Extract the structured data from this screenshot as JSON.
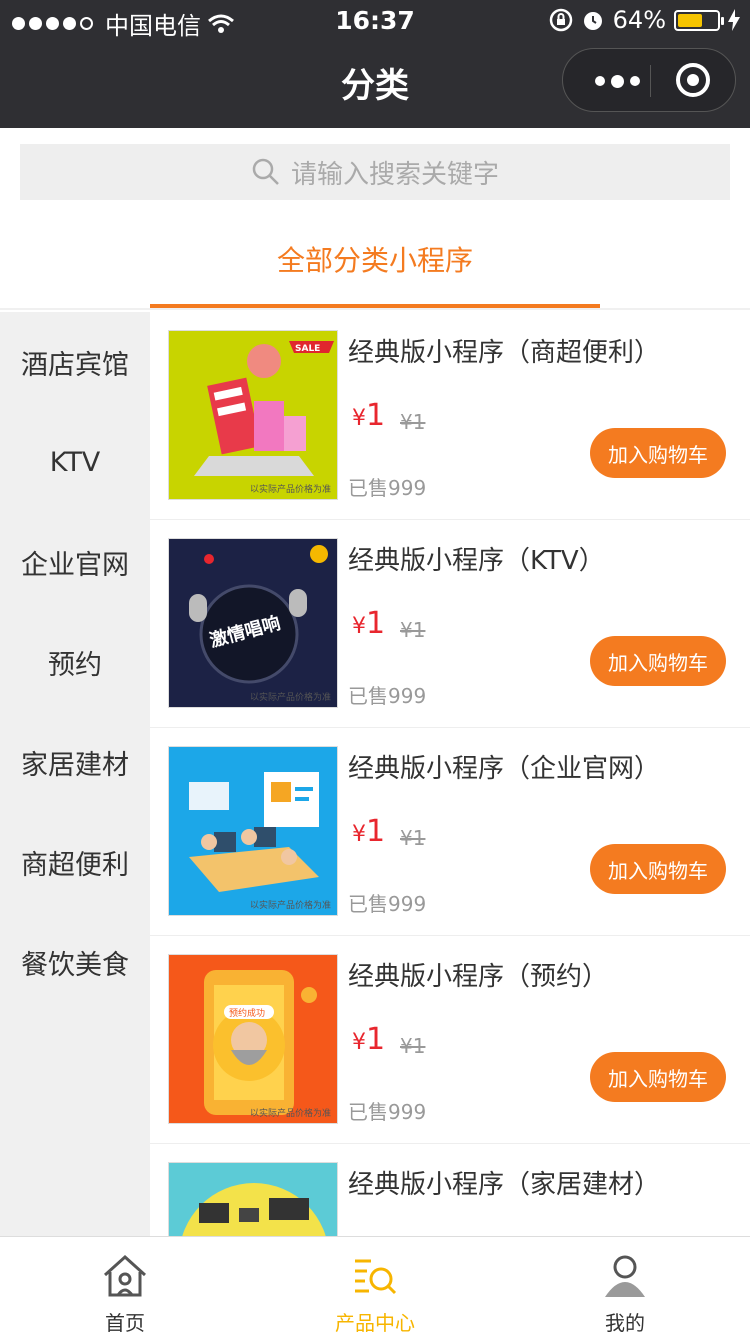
{
  "status_bar": {
    "carrier": "中国电信",
    "time": "16:37",
    "battery": "64%",
    "battery_level": 0.64
  },
  "nav": {
    "title": "分类",
    "more_icon": "more-dots-icon",
    "close_icon": "target-icon"
  },
  "search": {
    "placeholder": "请输入搜索关键字",
    "icon": "search-icon"
  },
  "category_header": "全部分类小程序",
  "sidebar": {
    "items": [
      {
        "label": "酒店宾馆"
      },
      {
        "label": "KTV"
      },
      {
        "label": "企业官网"
      },
      {
        "label": "预约"
      },
      {
        "label": "家居建材"
      },
      {
        "label": "商超便利"
      },
      {
        "label": "餐饮美食"
      }
    ]
  },
  "products": [
    {
      "title": "经典版小程序（商超便利）",
      "price_symbol": "¥",
      "price": "1",
      "original_price": "¥1",
      "sold": "已售999",
      "button": "加入购物车",
      "thumb_note": "以实际产品价格为准",
      "thumb_tag": "SALE",
      "thumb_bg": "#c8d400"
    },
    {
      "title": "经典版小程序（KTV）",
      "price_symbol": "¥",
      "price": "1",
      "original_price": "¥1",
      "sold": "已售999",
      "button": "加入购物车",
      "thumb_note": "以实际产品价格为准",
      "thumb_text": "激情唱响",
      "thumb_bg": "#1c2245"
    },
    {
      "title": "经典版小程序（企业官网）",
      "price_symbol": "¥",
      "price": "1",
      "original_price": "¥1",
      "sold": "已售999",
      "button": "加入购物车",
      "thumb_note": "以实际产品价格为准",
      "thumb_bg": "#1ca7e8"
    },
    {
      "title": "经典版小程序（预约）",
      "price_symbol": "¥",
      "price": "1",
      "original_price": "¥1",
      "sold": "已售999",
      "button": "加入购物车",
      "thumb_note": "以实际产品价格为准",
      "thumb_text": "预约成功",
      "thumb_bg": "#f5581a"
    },
    {
      "title": "经典版小程序（家居建材）",
      "thumb_bg": "#5ccbd6"
    }
  ],
  "tabbar": {
    "items": [
      {
        "label": "首页",
        "icon": "home-icon"
      },
      {
        "label": "产品中心",
        "icon": "product-search-icon"
      },
      {
        "label": "我的",
        "icon": "user-icon"
      }
    ]
  },
  "colors": {
    "accent": "#f47b20",
    "price": "#e8262e",
    "tab_active": "#f7b500",
    "nav_bg": "#2f2f33"
  }
}
